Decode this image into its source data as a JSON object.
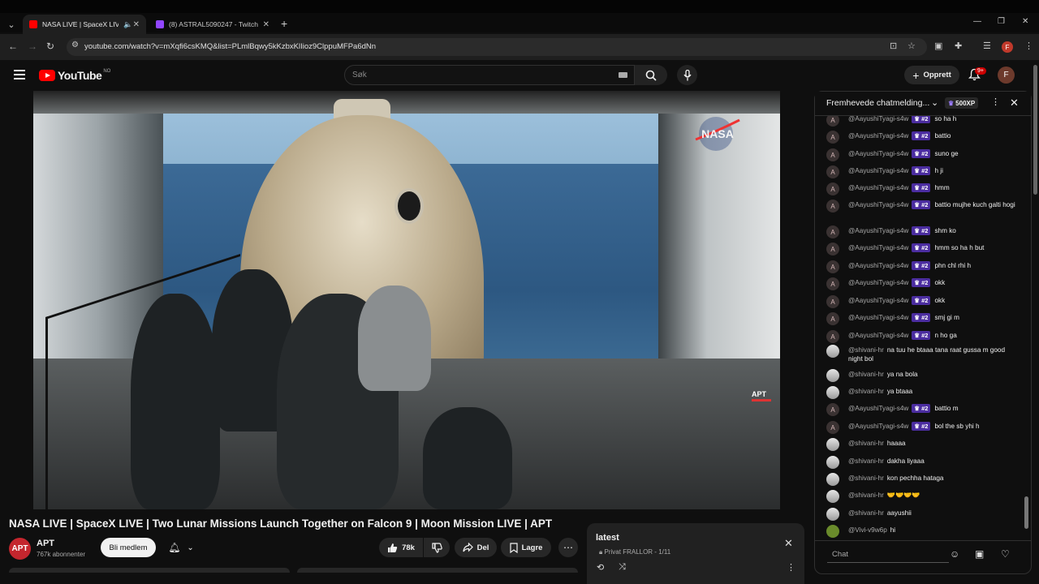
{
  "browser": {
    "tabs": [
      {
        "title": "NASA LIVE | SpaceX LIVE | T",
        "active": true,
        "favicon_color": "#ff0000"
      },
      {
        "title": "(8) ASTRAL5090247 - Twitch",
        "active": false,
        "favicon_color": "#9146ff"
      }
    ],
    "new_tab_label": "+",
    "url": "youtube.com/watch?v=mXqfi6csKMQ&list=PLmlBqwy5kKzbxKlIioz9ClppuMFPa6dNn",
    "profile_initial": "F"
  },
  "header": {
    "logo_text": "YouTube",
    "logo_country": "NO",
    "search_placeholder": "Søk",
    "create_label": "Opprett",
    "notif_count": "9+",
    "avatar_initial": "F"
  },
  "video": {
    "watermark_nasa": "NASA",
    "watermark_apt": "APT",
    "title": "NASA LIVE | SpaceX LIVE | Two Lunar Missions Launch Together on Falcon 9 | Moon Mission LIVE | APT"
  },
  "channel": {
    "avatar_text": "APT",
    "name": "APT",
    "subscribers": "767k abonnenter",
    "join_label": "Bli medlem"
  },
  "actions": {
    "likes": "78k",
    "share_label": "Del",
    "save_label": "Lagre"
  },
  "playlist": {
    "title": "latest",
    "privacy": "Privat",
    "owner_progress": "FRALLOR - 1/11"
  },
  "chat": {
    "header_title": "Fremhevede chatmelding...",
    "xp_label": "500XP",
    "input_placeholder": "Chat",
    "messages": [
      {
        "author": "@AayushiTyagi-s4w",
        "badge": "#2",
        "text": "so ha h",
        "avatar": "A"
      },
      {
        "author": "@AayushiTyagi-s4w",
        "badge": "#2",
        "text": "battio",
        "avatar": "A"
      },
      {
        "author": "@AayushiTyagi-s4w",
        "badge": "#2",
        "text": "suno ge",
        "avatar": "A"
      },
      {
        "author": "@AayushiTyagi-s4w",
        "badge": "#2",
        "text": "h ji",
        "avatar": "A"
      },
      {
        "author": "@AayushiTyagi-s4w",
        "badge": "#2",
        "text": "hmm",
        "avatar": "A"
      },
      {
        "author": "@AayushiTyagi-s4w",
        "badge": "#2",
        "text": "battio mujhe kuch galti hogi",
        "avatar": "A"
      },
      {
        "author": "@AayushiTyagi-s4w",
        "badge": "#2",
        "text": "shm ko",
        "avatar": "A"
      },
      {
        "author": "@AayushiTyagi-s4w",
        "badge": "#2",
        "text": "hmm so ha h but",
        "avatar": "A"
      },
      {
        "author": "@AayushiTyagi-s4w",
        "badge": "#2",
        "text": "phn chl rhi h",
        "avatar": "A"
      },
      {
        "author": "@AayushiTyagi-s4w",
        "badge": "#2",
        "text": "okk",
        "avatar": "A"
      },
      {
        "author": "@AayushiTyagi-s4w",
        "badge": "#2",
        "text": "okk",
        "avatar": "A"
      },
      {
        "author": "@AayushiTyagi-s4w",
        "badge": "#2",
        "text": "smj gi m",
        "avatar": "A"
      },
      {
        "author": "@AayushiTyagi-s4w",
        "badge": "#2",
        "text": "n ho ga",
        "avatar": "A"
      },
      {
        "author": "@shivani-hr",
        "badge": "",
        "text": "na tuu he btaaa tana raat gussa m good night bol",
        "avatar": ""
      },
      {
        "author": "@shivani-hr",
        "badge": "",
        "text": "ya na bola",
        "avatar": ""
      },
      {
        "author": "@shivani-hr",
        "badge": "",
        "text": "ya btaaa",
        "avatar": ""
      },
      {
        "author": "@AayushiTyagi-s4w",
        "badge": "#2",
        "text": "battio m",
        "avatar": "A"
      },
      {
        "author": "@AayushiTyagi-s4w",
        "badge": "#2",
        "text": "bol the sb yhi h",
        "avatar": "A"
      },
      {
        "author": "@shivani-hr",
        "badge": "",
        "text": "haaaa",
        "avatar": ""
      },
      {
        "author": "@shivani-hr",
        "badge": "",
        "text": "dakha liyaaa",
        "avatar": ""
      },
      {
        "author": "@shivani-hr",
        "badge": "",
        "text": "kon pechha hataga",
        "avatar": ""
      },
      {
        "author": "@shivani-hr",
        "badge": "",
        "text": "🤝🤝🤝🤝",
        "avatar": ""
      },
      {
        "author": "@shivani-hr",
        "badge": "",
        "text": "aayushii",
        "avatar": ""
      },
      {
        "author": "@Vivi-v9w6p",
        "badge": "",
        "text": "hi",
        "avatar": ""
      }
    ]
  }
}
